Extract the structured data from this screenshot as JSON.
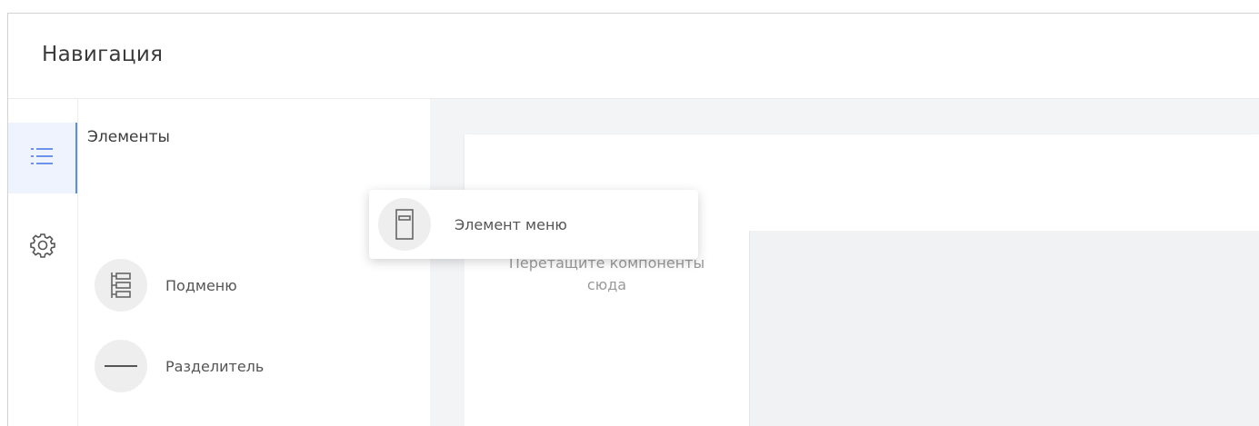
{
  "header": {
    "title": "Навигация"
  },
  "rail": {
    "items": [
      {
        "icon": "list-icon",
        "active": true
      },
      {
        "icon": "gear-icon",
        "active": false
      }
    ]
  },
  "panel": {
    "title": "Элементы",
    "items": [
      {
        "label": "Подменю",
        "icon": "submenu-icon"
      },
      {
        "label": "Разделитель",
        "icon": "divider-icon"
      }
    ]
  },
  "canvas": {
    "drop_hint_line1": "Перетащите компоненты",
    "drop_hint_line2": "сюда"
  },
  "drag_ghost": {
    "label": "Элемент меню",
    "icon": "menu-item-icon"
  },
  "colors": {
    "accent": "#5b8def",
    "canvas_bg": "#f3f4f6",
    "icon_bg": "#eeeeee"
  }
}
